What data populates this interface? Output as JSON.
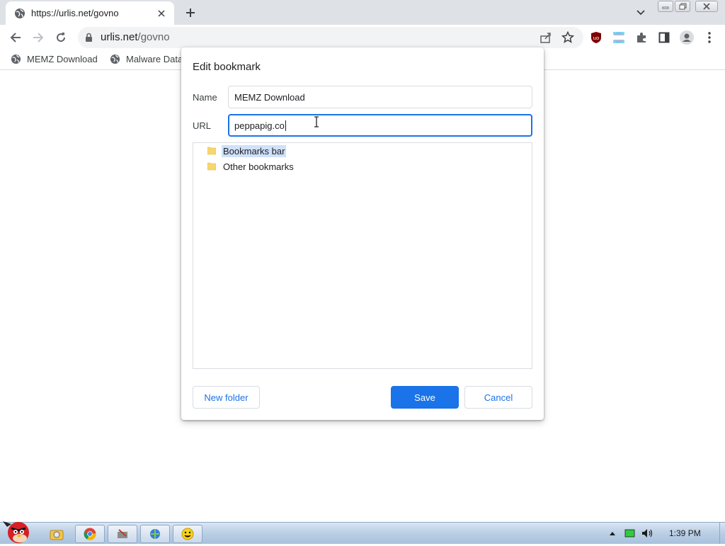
{
  "browser": {
    "tab_title": "https://urlis.net/govno",
    "omnibox_host": "urlis.net",
    "omnibox_path": "/govno"
  },
  "bookmarks_bar": {
    "items": [
      {
        "label": "MEMZ Download"
      },
      {
        "label": "Malware Data"
      }
    ]
  },
  "dialog": {
    "title": "Edit bookmark",
    "name_label": "Name",
    "name_value": "MEMZ Download",
    "url_label": "URL",
    "url_value": "peppapig.co",
    "folders": [
      {
        "label": "Bookmarks bar",
        "selected": true
      },
      {
        "label": "Other bookmarks",
        "selected": false
      }
    ],
    "new_folder_label": "New folder",
    "save_label": "Save",
    "cancel_label": "Cancel"
  },
  "taskbar": {
    "clock": "1:39 PM"
  },
  "colors": {
    "accent": "#1a73e8",
    "selection": "#cfe1fb",
    "folder": "#f6d66e"
  }
}
